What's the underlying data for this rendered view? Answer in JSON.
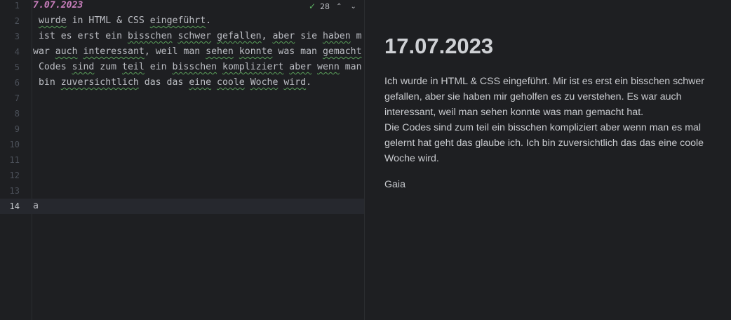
{
  "editor": {
    "inspection": {
      "count": "28",
      "check_icon": "✓",
      "up_icon": "⌃",
      "down_icon": "⌄"
    },
    "lines": [
      {
        "n": "1",
        "segments": [
          {
            "t": "7.07.2023"
          }
        ]
      },
      {
        "n": "2",
        "segments": [
          {
            "t": " "
          },
          {
            "t": "wurde",
            "typo": true
          },
          {
            "t": " in HTML & CSS "
          },
          {
            "t": "eingeführt",
            "typo": true
          },
          {
            "t": "."
          }
        ]
      },
      {
        "n": "3",
        "segments": [
          {
            "t": " ist es erst ein "
          },
          {
            "t": "bisschen",
            "typo": true
          },
          {
            "t": " "
          },
          {
            "t": "schwer",
            "typo": true
          },
          {
            "t": " "
          },
          {
            "t": "gefallen",
            "typo": true
          },
          {
            "t": ", "
          },
          {
            "t": "aber",
            "typo": true
          },
          {
            "t": " sie "
          },
          {
            "t": "haben",
            "typo": true
          },
          {
            "t": " m"
          }
        ]
      },
      {
        "n": "4",
        "segments": [
          {
            "t": "war "
          },
          {
            "t": "auch",
            "typo": true
          },
          {
            "t": " "
          },
          {
            "t": "interessant",
            "typo": true
          },
          {
            "t": ", weil man "
          },
          {
            "t": "sehen",
            "typo": true
          },
          {
            "t": " "
          },
          {
            "t": "konnte",
            "typo": true
          },
          {
            "t": " was man "
          },
          {
            "t": "gemacht",
            "typo": true
          }
        ]
      },
      {
        "n": "5",
        "segments": [
          {
            "t": " Codes "
          },
          {
            "t": "sind",
            "typo": true
          },
          {
            "t": " zum "
          },
          {
            "t": "teil",
            "typo": true
          },
          {
            "t": " ein "
          },
          {
            "t": "bisschen",
            "typo": true
          },
          {
            "t": " "
          },
          {
            "t": "kompliziert",
            "typo": true
          },
          {
            "t": " "
          },
          {
            "t": "aber",
            "typo": true
          },
          {
            "t": " "
          },
          {
            "t": "wenn",
            "typo": true
          },
          {
            "t": " man"
          }
        ]
      },
      {
        "n": "6",
        "segments": [
          {
            "t": " bin "
          },
          {
            "t": "zuversichtlich",
            "typo": true
          },
          {
            "t": " das das "
          },
          {
            "t": "eine",
            "typo": true
          },
          {
            "t": " "
          },
          {
            "t": "coole",
            "typo": true
          },
          {
            "t": " "
          },
          {
            "t": "Woche",
            "typo": true
          },
          {
            "t": " "
          },
          {
            "t": "wird",
            "typo": true
          },
          {
            "t": "."
          }
        ]
      },
      {
        "n": "7",
        "segments": []
      },
      {
        "n": "8",
        "segments": []
      },
      {
        "n": "9",
        "segments": []
      },
      {
        "n": "10",
        "segments": []
      },
      {
        "n": "11",
        "segments": []
      },
      {
        "n": "12",
        "segments": []
      },
      {
        "n": "13",
        "segments": []
      },
      {
        "n": "14",
        "segments": [
          {
            "t": "a"
          }
        ]
      }
    ]
  },
  "preview": {
    "title": "17.07.2023",
    "paragraph": "Ich wurde in HTML & CSS eingeführt. Mir ist es erst ein bisschen schwer gefallen, aber sie haben mir geholfen es zu verstehen. Es war auch interessant, weil man sehen konnte was man gemacht hat.\nDie Codes sind zum teil ein bisschen kompliziert aber wenn man es mal gelernt hat geht das glaube ich. Ich bin zuversichtlich das das eine coole Woche wird.",
    "signature": "Gaia"
  }
}
